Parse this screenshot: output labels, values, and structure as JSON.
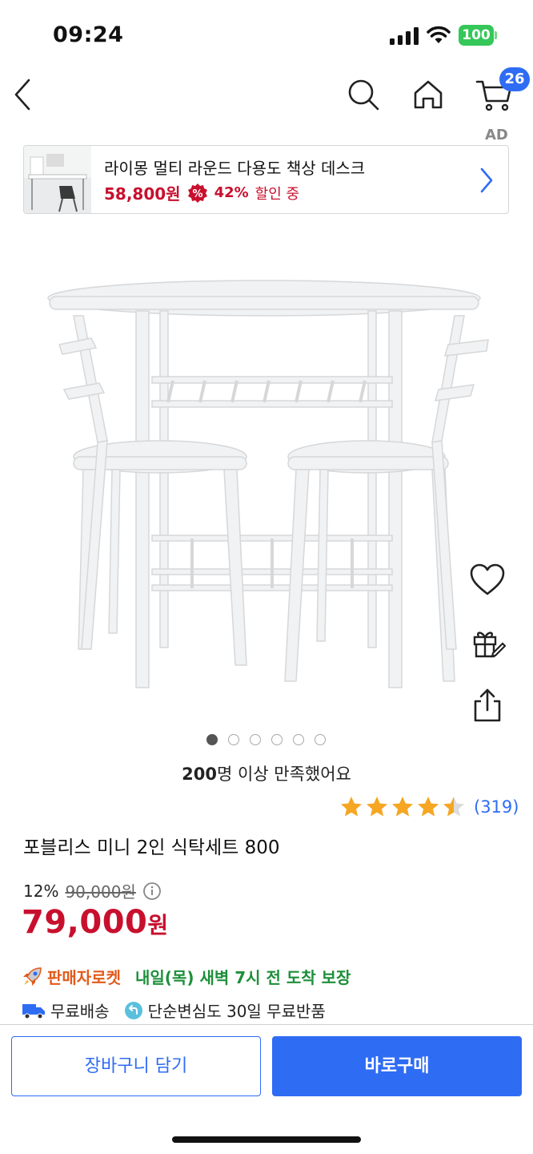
{
  "status_bar": {
    "time": "09:24",
    "battery": "100"
  },
  "nav": {
    "cart_count": "26"
  },
  "ad": {
    "label": "AD",
    "title": "라이몽 멀티 라운드 다용도 책상 데스크",
    "price": "58,800원",
    "discount": "42%",
    "discount_suffix": "할인 중"
  },
  "gallery": {
    "image_count": 6,
    "active_index": 0
  },
  "satisfaction": {
    "count": "200",
    "text": "명 이상 만족했어요"
  },
  "rating": {
    "stars": 4.5,
    "review_count": "(319)"
  },
  "product": {
    "title": "포블리스 미니 2인 식탁세트 800",
    "discount_rate": "12%",
    "original_price": "90,000원",
    "sale_price": "79,000",
    "sale_unit": "원"
  },
  "delivery": {
    "badge": "판매자로켓",
    "arrival": "내일(목) 새벽 7시 전 도착 보장"
  },
  "shipping": {
    "free_shipping": "무료배송",
    "free_return": "단순변심도 30일 무료반품"
  },
  "buttons": {
    "add_to_cart": "장바구니 담기",
    "buy_now": "바로구매"
  },
  "colors": {
    "accent": "#2f6cf4",
    "price": "#c8102e",
    "star": "#f5a623",
    "arrival": "#1d8f3a",
    "rocket": "#e35a1b"
  }
}
